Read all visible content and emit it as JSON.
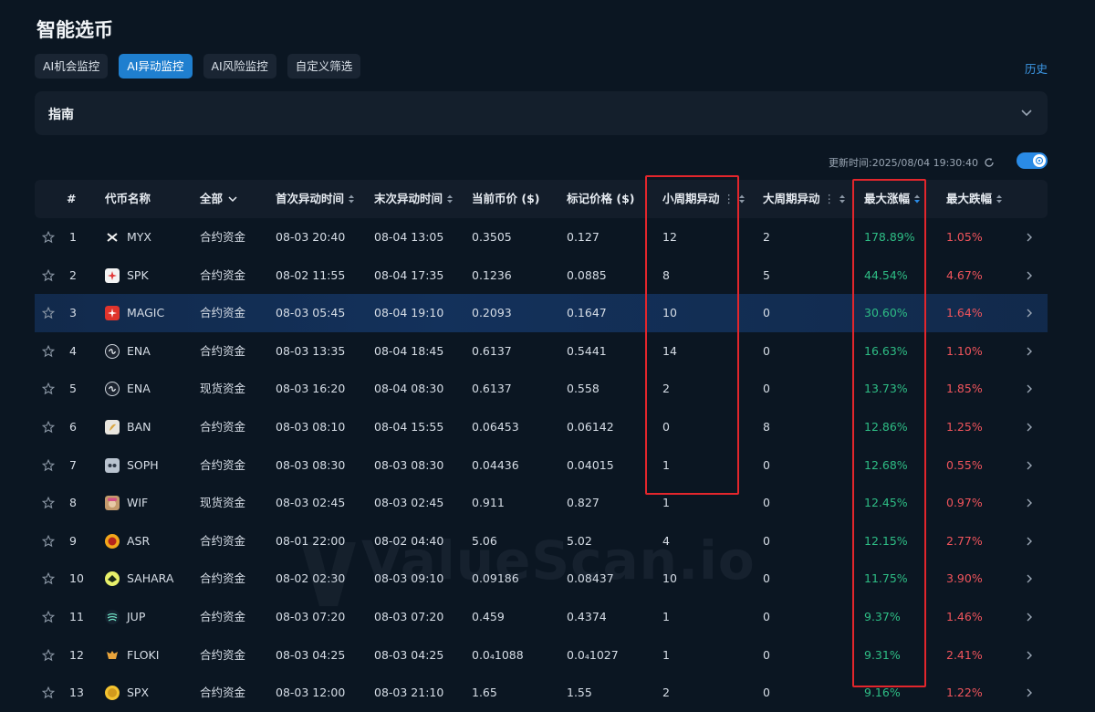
{
  "page": {
    "title": "智能选币",
    "history_label": "历史",
    "update_time": "更新时间:2025/08/04 19:30:40"
  },
  "tabs": [
    {
      "label": "AI机会监控",
      "active": false
    },
    {
      "label": "AI异动监控",
      "active": true
    },
    {
      "label": "AI风险监控",
      "active": false
    },
    {
      "label": "自定义筛选",
      "active": false
    }
  ],
  "guide": {
    "title": "指南"
  },
  "watermark": "ValueScan.io",
  "colors": {
    "accent": "#1f7fcf",
    "up": "#2ebd85",
    "down": "#f0545c",
    "highlight_box": "#e3262c"
  },
  "table": {
    "headers": {
      "index": "#",
      "coin": "代币名称",
      "fund": "全部",
      "first_time": "首次异动时间",
      "last_time": "末次异动时间",
      "price": "当前币价 ($)",
      "mark": "标记价格 ($)",
      "small": "小周期异动",
      "large": "大周期异动",
      "max_up": "最大涨幅",
      "max_down": "最大跌幅"
    },
    "rows": [
      {
        "index": "1",
        "icon": "myx-icon",
        "coin": "MYX",
        "fund": "合约资金",
        "first": "08-03 20:40",
        "last": "08-04 13:05",
        "price": "0.3505",
        "mark": "0.127",
        "small": "12",
        "large": "2",
        "up": "178.89%",
        "down": "1.05%"
      },
      {
        "index": "2",
        "icon": "spk-icon",
        "coin": "SPK",
        "fund": "合约资金",
        "first": "08-02 11:55",
        "last": "08-04 17:35",
        "price": "0.1236",
        "mark": "0.0885",
        "small": "8",
        "large": "5",
        "up": "44.54%",
        "down": "4.67%"
      },
      {
        "index": "3",
        "icon": "magic-icon",
        "coin": "MAGIC",
        "fund": "合约资金",
        "first": "08-03 05:45",
        "last": "08-04 19:10",
        "price": "0.2093",
        "mark": "0.1647",
        "small": "10",
        "large": "0",
        "up": "30.60%",
        "down": "1.64%"
      },
      {
        "index": "4",
        "icon": "ena-icon",
        "coin": "ENA",
        "fund": "合约资金",
        "first": "08-03 13:35",
        "last": "08-04 18:45",
        "price": "0.6137",
        "mark": "0.5441",
        "small": "14",
        "large": "0",
        "up": "16.63%",
        "down": "1.10%"
      },
      {
        "index": "5",
        "icon": "ena-icon",
        "coin": "ENA",
        "fund": "现货资金",
        "first": "08-03 16:20",
        "last": "08-04 08:30",
        "price": "0.6137",
        "mark": "0.558",
        "small": "2",
        "large": "0",
        "up": "13.73%",
        "down": "1.85%"
      },
      {
        "index": "6",
        "icon": "ban-icon",
        "coin": "BAN",
        "fund": "合约资金",
        "first": "08-03 08:10",
        "last": "08-04 15:55",
        "price": "0.06453",
        "mark": "0.06142",
        "small": "0",
        "large": "8",
        "up": "12.86%",
        "down": "1.25%"
      },
      {
        "index": "7",
        "icon": "soph-icon",
        "coin": "SOPH",
        "fund": "合约资金",
        "first": "08-03 08:30",
        "last": "08-03 08:30",
        "price": "0.04436",
        "mark": "0.04015",
        "small": "1",
        "large": "0",
        "up": "12.68%",
        "down": "0.55%"
      },
      {
        "index": "8",
        "icon": "wif-icon",
        "coin": "WIF",
        "fund": "现货资金",
        "first": "08-03 02:45",
        "last": "08-03 02:45",
        "price": "0.911",
        "mark": "0.827",
        "small": "1",
        "large": "0",
        "up": "12.45%",
        "down": "0.97%"
      },
      {
        "index": "9",
        "icon": "asr-icon",
        "coin": "ASR",
        "fund": "合约资金",
        "first": "08-01 22:00",
        "last": "08-02 04:40",
        "price": "5.06",
        "mark": "5.02",
        "small": "4",
        "large": "0",
        "up": "12.15%",
        "down": "2.77%"
      },
      {
        "index": "10",
        "icon": "sahara-icon",
        "coin": "SAHARA",
        "fund": "合约资金",
        "first": "08-02 02:30",
        "last": "08-03 09:10",
        "price": "0.09186",
        "mark": "0.08437",
        "small": "10",
        "large": "0",
        "up": "11.75%",
        "down": "3.90%"
      },
      {
        "index": "11",
        "icon": "jup-icon",
        "coin": "JUP",
        "fund": "合约资金",
        "first": "08-03 07:20",
        "last": "08-03 07:20",
        "price": "0.459",
        "mark": "0.4374",
        "small": "1",
        "large": "0",
        "up": "9.37%",
        "down": "1.46%"
      },
      {
        "index": "12",
        "icon": "floki-icon",
        "coin": "FLOKI",
        "fund": "合约资金",
        "first": "08-03 04:25",
        "last": "08-03 04:25",
        "price": "0.0₄1088",
        "mark": "0.0₄1027",
        "small": "1",
        "large": "0",
        "up": "9.31%",
        "down": "2.41%"
      },
      {
        "index": "13",
        "icon": "spx-icon",
        "coin": "SPX",
        "fund": "合约资金",
        "first": "08-03 12:00",
        "last": "08-03 21:10",
        "price": "1.65",
        "mark": "1.55",
        "small": "2",
        "large": "0",
        "up": "9.16%",
        "down": "1.22%"
      }
    ]
  }
}
